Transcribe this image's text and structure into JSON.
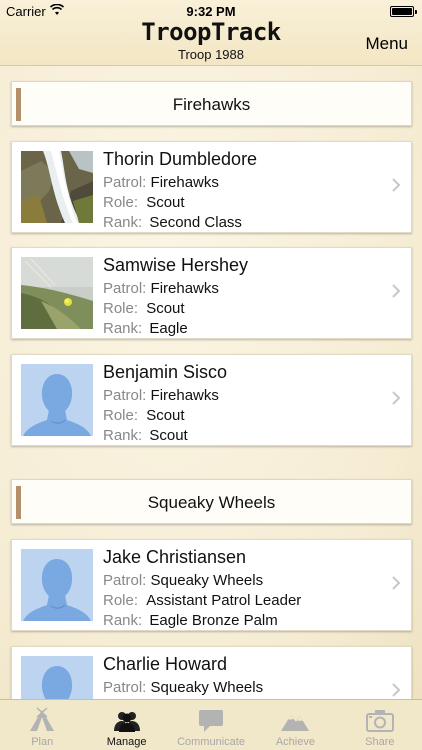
{
  "status_bar": {
    "carrier": "Carrier",
    "time": "9:32 PM"
  },
  "header": {
    "brand": "TroopTrack",
    "subtitle": "Troop 1988",
    "menu_label": "Menu"
  },
  "labels": {
    "patrol": "Patrol:",
    "role": "Role:",
    "rank": "Rank:"
  },
  "sections": [
    {
      "title": "Firehawks",
      "members": [
        {
          "name": "Thorin Dumbledore",
          "patrol": "Firehawks",
          "role": "Scout",
          "rank": "Second Class",
          "avatar": "waterfall-photo"
        },
        {
          "name": "Samwise Hershey",
          "patrol": "Firehawks",
          "role": "Scout",
          "rank": "Eagle",
          "avatar": "meadow-photo"
        },
        {
          "name": "Benjamin Sisco",
          "patrol": "Firehawks",
          "role": "Scout",
          "rank": "Scout",
          "avatar": "default-person-silhouette"
        }
      ]
    },
    {
      "title": "Squeaky Wheels",
      "members": [
        {
          "name": "Jake Christiansen",
          "patrol": "Squeaky Wheels",
          "role": "Assistant Patrol Leader",
          "rank": "Eagle Bronze Palm",
          "avatar": "default-person-silhouette"
        },
        {
          "name": "Charlie Howard",
          "patrol": "Squeaky Wheels",
          "avatar": "default-person-silhouette"
        }
      ]
    }
  ],
  "tabs": [
    {
      "label": "Plan",
      "icon": "tent-icon",
      "active": false
    },
    {
      "label": "Manage",
      "icon": "people-icon",
      "active": true
    },
    {
      "label": "Communicate",
      "icon": "speech-bubble-icon",
      "active": false
    },
    {
      "label": "Achieve",
      "icon": "mountain-icon",
      "active": false
    },
    {
      "label": "Share",
      "icon": "camera-icon",
      "active": false
    }
  ],
  "colors": {
    "accent_bar": "#b48f6b",
    "background": "#f7f0dc",
    "tab_inactive": "#a8a8a8",
    "avatar_placeholder": "#bcd4f0"
  }
}
